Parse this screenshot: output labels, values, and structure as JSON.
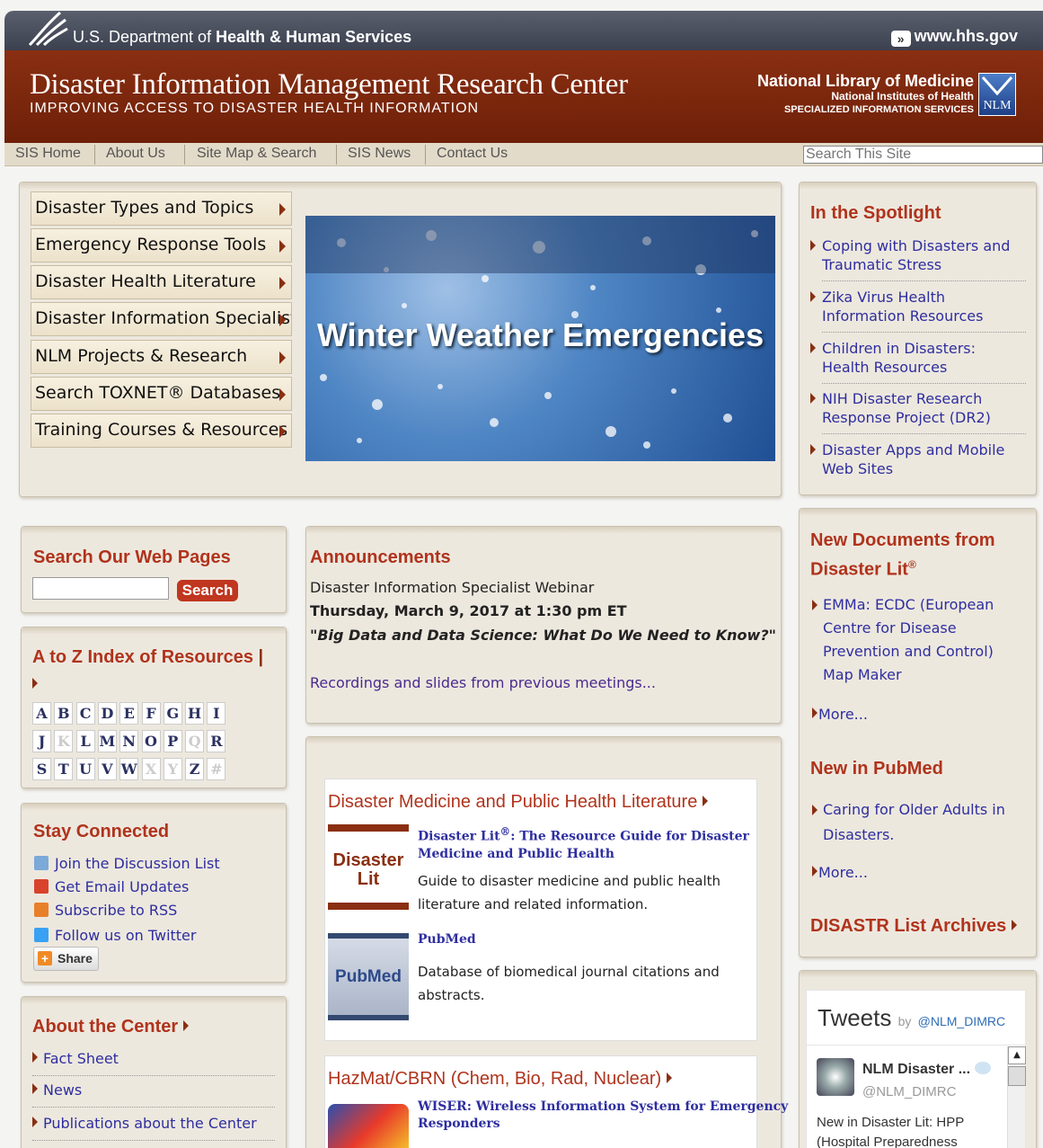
{
  "hhs_bar": {
    "dept_prefix": "U.S. Department of",
    "dept_bold": "Health & Human Services",
    "url": "www.hhs.gov"
  },
  "banner": {
    "title": "Disaster Information Management Research Center",
    "subtitle": "IMPROVING ACCESS TO DISASTER HEALTH INFORMATION",
    "nlm_line1": "National Library of Medicine",
    "nlm_line2": "National Institutes of Health",
    "nlm_line3": "SPECIALIZED INFORMATION SERVICES",
    "nlm_logo": "NLM"
  },
  "nav": {
    "items": [
      "SIS Home",
      "About Us",
      "Site Map & Search",
      "SIS News",
      "Contact Us"
    ],
    "search_placeholder": "Search This Site"
  },
  "menu": [
    "Disaster Types and Topics",
    "Emergency Response Tools",
    "Disaster Health Literature",
    "Disaster Information Specialist",
    "NLM Projects & Research",
    "Search TOXNET® Databases",
    "Training Courses & Resources"
  ],
  "hero": {
    "caption": "Winter Weather Emergencies"
  },
  "spotlight": {
    "heading": "In the Spotlight",
    "items": [
      [
        "Coping with Disasters and",
        "Traumatic Stress"
      ],
      [
        "Zika Virus Health",
        "Information Resources"
      ],
      [
        "Children in Disasters:",
        "Health Resources"
      ],
      [
        "NIH Disaster Research",
        "Response Project (DR2)"
      ],
      [
        "Disaster Apps and Mobile",
        "Web Sites"
      ]
    ]
  },
  "search_pages": {
    "heading": "Search Our Web Pages",
    "button": "Search"
  },
  "az": {
    "heading": "A to Z Index of Resources",
    "rows": [
      [
        "A",
        "B",
        "C",
        "D",
        "E",
        "F",
        "G",
        "H",
        "I"
      ],
      [
        "J",
        "K",
        "L",
        "M",
        "N",
        "O",
        "P",
        "Q",
        "R"
      ],
      [
        "S",
        "T",
        "U",
        "V",
        "W",
        "X",
        "Y",
        "Z",
        "#"
      ]
    ],
    "dim": [
      "K",
      "Q",
      "X",
      "Y",
      "#"
    ]
  },
  "stay": {
    "heading": "Stay Connected",
    "items": [
      "Join the Discussion List",
      "Get Email Updates",
      "Subscribe to RSS",
      "Follow us on Twitter"
    ],
    "share": "Share",
    "icon_colors": [
      "#7ba9d8",
      "#d9432c",
      "#e8802a",
      "#38a1f3"
    ]
  },
  "about": {
    "heading": "About the Center",
    "items": [
      "Fact Sheet",
      "News",
      "Publications about the Center"
    ]
  },
  "announcements": {
    "heading": "Announcements",
    "line1": "Disaster Information Specialist Webinar",
    "line2": "Thursday, March 9, 2017 at 1:30 pm ET",
    "line3": "\"Big Data and Data Science: What Do We Need to Know?\"",
    "link": "Recordings and slides from previous meetings..."
  },
  "literature": {
    "heading": "Disaster Medicine and Public Health Literature",
    "item1": {
      "thumb1": "Disaster",
      "thumb2": "Lit",
      "title_a": "Disaster Lit",
      "title_sup": "®",
      "title_b": ": The Resource Guide for Disaster",
      "title_c": "Medicine and Public Health",
      "desc1": "Guide to disaster medicine and public health",
      "desc2": "literature and related information."
    },
    "item2": {
      "thumb": "PubMed",
      "title": "PubMed",
      "desc1": "Database of biomedical journal citations and",
      "desc2": "abstracts."
    }
  },
  "hazmat": {
    "heading": "HazMat/CBRN (Chem, Bio, Rad, Nuclear)",
    "title1": "WISER: Wireless Information System for Emergency",
    "title2": "Responders"
  },
  "newdocs": {
    "heading1": "New Documents from",
    "heading2": "Disaster Lit",
    "sup": "®",
    "item": [
      "EMMa: ECDC (European",
      "Centre for Disease",
      "Prevention and Control)",
      "Map Maker"
    ],
    "more": "More..."
  },
  "pubmed_new": {
    "heading": "New in PubMed",
    "item": [
      "Caring for Older Adults in",
      "Disasters."
    ],
    "more": "More..."
  },
  "archives": {
    "heading": "DISASTR List Archives"
  },
  "tweets": {
    "title": "Tweets",
    "by": "by",
    "handle": "@NLM_DIMRC",
    "account": "NLM Disaster ...",
    "account_handle": "@NLM_DIMRC",
    "text1": "New in Disaster Lit: HPP",
    "text2": "(Hospital Preparedness"
  }
}
